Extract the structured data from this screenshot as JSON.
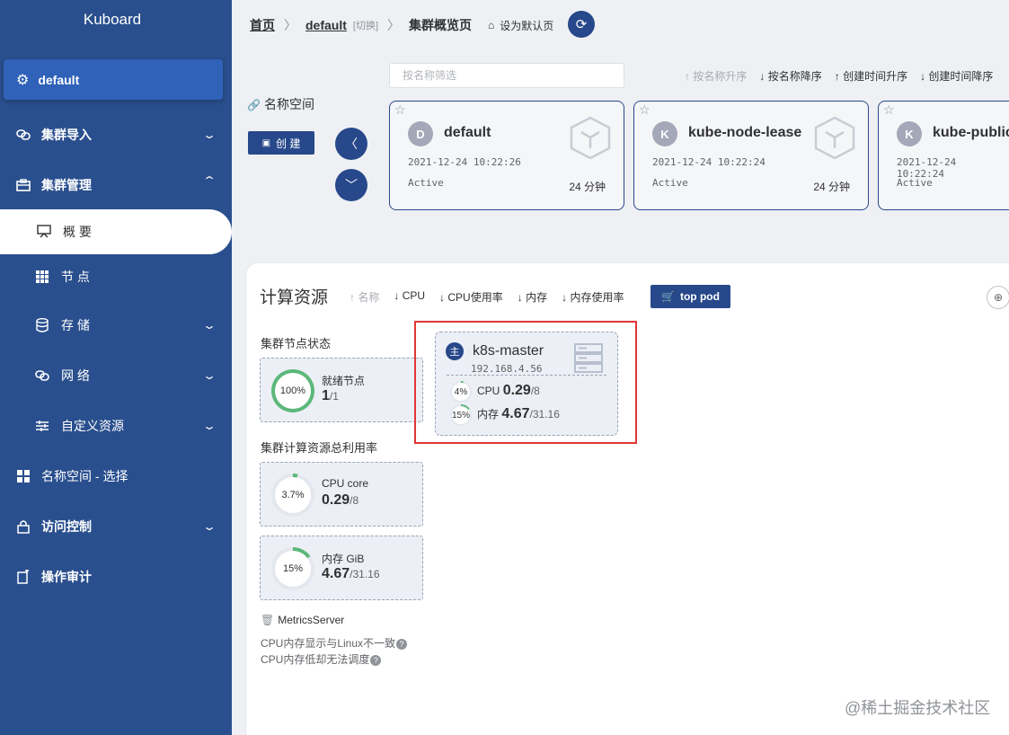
{
  "sidebar": {
    "brand": "Kuboard",
    "active_cluster": "default",
    "items": [
      {
        "label": "集群导入"
      },
      {
        "label": "集群管理"
      },
      {
        "label": "概 要"
      },
      {
        "label": "节 点"
      },
      {
        "label": "存 储"
      },
      {
        "label": "网 络"
      },
      {
        "label": "自定义资源"
      },
      {
        "label": "名称空间 - 选择"
      },
      {
        "label": "访问控制"
      },
      {
        "label": "操作审计"
      }
    ]
  },
  "breadcrumb": {
    "home": "首页",
    "cluster": "default",
    "switch": "[切换]",
    "current": "集群概览页",
    "set_default": "设为默认页"
  },
  "namespace": {
    "label": "名称空间",
    "filter_placeholder": "按名称筛选",
    "create_label": "创 建",
    "sort": [
      "按名称升序",
      "按名称降序",
      "创建时间升序",
      "创建时间降序"
    ],
    "cards": [
      {
        "letter": "D",
        "name": "default",
        "created": "2021-12-24 10:22:26",
        "status": "Active",
        "age": "24 分钟"
      },
      {
        "letter": "K",
        "name": "kube-node-lease",
        "created": "2021-12-24 10:22:24",
        "status": "Active",
        "age": "24 分钟"
      },
      {
        "letter": "K",
        "name": "kube-public",
        "created": "2021-12-24 10:22:24",
        "status": "Active",
        "age": ""
      }
    ]
  },
  "compute": {
    "title": "计算资源",
    "sort": [
      "名称",
      "CPU",
      "CPU使用率",
      "内存",
      "内存使用率"
    ],
    "top_pod": "top pod",
    "node_status_title": "集群节点状态",
    "ready_nodes": {
      "percent": "100%",
      "label": "就绪节点",
      "value": "1",
      "total": "/1",
      "ratio": 1.0
    },
    "usage_title": "集群计算资源总利用率",
    "cpu": {
      "percent": "3.7%",
      "label": "CPU core",
      "value": "0.29",
      "total": "/8",
      "ratio": 0.037
    },
    "mem": {
      "percent": "15%",
      "label": "内存 GiB",
      "value": "4.67",
      "total": "/31.16",
      "ratio": 0.15
    },
    "metrics_server": "MetricsServer",
    "note1": "CPU内存显示与Linux不一致",
    "note2": "CPU内存低却无法调度",
    "node": {
      "badge": "主",
      "name": "k8s-master",
      "ip": "192.168.4.56",
      "cpu_percent": "4%",
      "cpu_label": "CPU",
      "cpu_value": "0.29",
      "cpu_total": "/8",
      "cpu_ratio": 0.04,
      "mem_percent": "15%",
      "mem_label": "内存",
      "mem_value": "4.67",
      "mem_total": "/31.16",
      "mem_ratio": 0.15
    }
  },
  "watermark": "@稀土掘金技术社区",
  "colors": {
    "sidebar": "#2a4f8e",
    "primary": "#27488a",
    "ring_green": "#5cb87a",
    "highlight": "#e03636"
  }
}
